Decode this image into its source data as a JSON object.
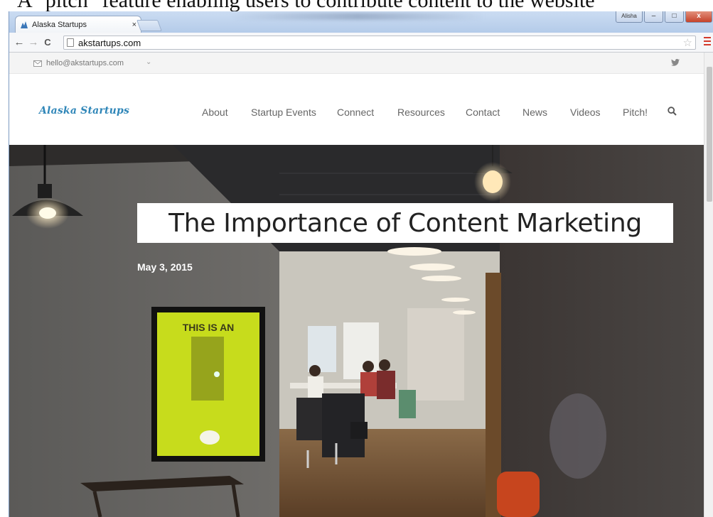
{
  "caption": {
    "text": "A \"pitch\" feature enabling users to contribute content to the website"
  },
  "browser": {
    "tab_title": "Alaska Startups",
    "tab_close": "×",
    "url": "akstartups.com",
    "user_button": "Alisha",
    "minimize": "–",
    "maximize": "□",
    "close": "x",
    "back": "←",
    "forward": "→",
    "reload": "C",
    "bookmark": "☆"
  },
  "topbar": {
    "email": "hello@akstartups.com",
    "caret": "⌄",
    "twitter": "🐦"
  },
  "site": {
    "logo": "Alaska Startups",
    "nav": [
      "About",
      "Startup Events",
      "Connect",
      "Resources",
      "Contact",
      "News",
      "Videos",
      "Pitch!"
    ]
  },
  "hero": {
    "title": "The Importance of Content Marketing",
    "date": "May 3, 2015",
    "poster_text": "THIS IS AN"
  },
  "colors": {
    "logo": "#2f86b8",
    "poster": "#c7dc1c",
    "close_button": "#c6432b"
  }
}
